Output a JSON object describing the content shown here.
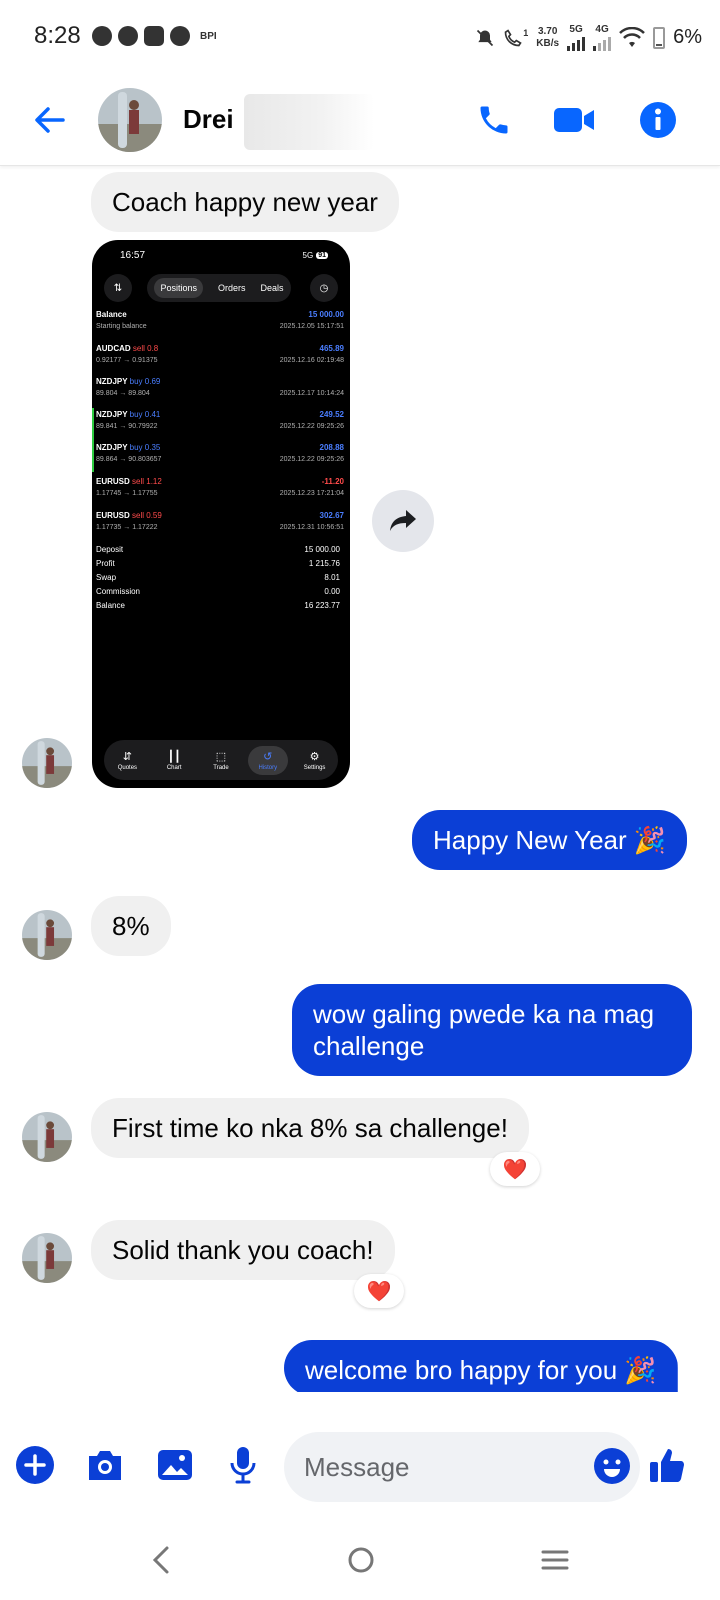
{
  "status_bar": {
    "time": "8:28",
    "carrier_tag": "BPI",
    "call_indicator": "1",
    "speed_value": "3.70",
    "speed_unit": "KB/s",
    "net1": "5G",
    "net2": "4G",
    "battery": "6%"
  },
  "header": {
    "contact_name": "Drei",
    "icons": [
      "back-arrow-icon",
      "phone-icon",
      "video-icon",
      "info-icon"
    ],
    "accent_color": "#0866ff"
  },
  "messages": [
    {
      "id": "m1",
      "direction": "in",
      "text": "Coach happy new year"
    },
    {
      "id": "m2",
      "direction": "in",
      "type": "image"
    },
    {
      "id": "m3",
      "direction": "out",
      "text": "Happy New Year 🎉"
    },
    {
      "id": "m4",
      "direction": "in",
      "text": "8%"
    },
    {
      "id": "m5",
      "direction": "out",
      "text": "wow galing pwede ka na mag challenge"
    },
    {
      "id": "m6",
      "direction": "in",
      "text": "First time ko nka 8% sa challenge!",
      "reaction": "❤️"
    },
    {
      "id": "m7",
      "direction": "in",
      "text": "Solid thank you coach!",
      "reaction": "❤️"
    },
    {
      "id": "m8",
      "direction": "out",
      "text": "welcome bro happy for you 🎉"
    }
  ],
  "shared_image": {
    "time": "16:57",
    "network": "5G",
    "battery": "91",
    "tabs": [
      "Positions",
      "Orders",
      "Deals"
    ],
    "active_tab": "Positions",
    "rows": [
      {
        "title": "Balance",
        "side": "",
        "sub": "Starting balance",
        "value": "15 000.00",
        "date": "2025.12.05 15:17:51"
      },
      {
        "title": "AUDCAD",
        "side": "sell 0.8",
        "sub": "0.92177 → 0.91375",
        "value": "465.89",
        "date": "2025.12.16 02:19:48"
      },
      {
        "title": "NZDJPY",
        "side": "buy 0.69",
        "sub": "89.804 → 89.804",
        "value": "",
        "date": "2025.12.17 10:14:24"
      },
      {
        "title": "NZDJPY",
        "side": "buy 0.41",
        "sub": "89.841 → 90.79922",
        "value": "249.52",
        "date": "2025.12.22 09:25:26"
      },
      {
        "title": "NZDJPY",
        "side": "buy 0.35",
        "sub": "89.864 → 90.803657",
        "value": "208.88",
        "date": "2025.12.22 09:25:26"
      },
      {
        "title": "EURUSD",
        "side": "sell 1.12",
        "sub": "1.17745 → 1.17755",
        "value": "-11.20",
        "date": "2025.12.23 17:21:04"
      },
      {
        "title": "EURUSD",
        "side": "sell 0.59",
        "sub": "1.17735 → 1.17222",
        "value": "302.67",
        "date": "2025.12.31 10:56:51"
      }
    ],
    "summary": [
      {
        "label": "Deposit",
        "value": "15 000.00"
      },
      {
        "label": "Profit",
        "value": "1 215.76"
      },
      {
        "label": "Swap",
        "value": "8.01"
      },
      {
        "label": "Commission",
        "value": "0.00"
      },
      {
        "label": "Balance",
        "value": "16 223.77"
      }
    ],
    "nav": [
      "Quotes",
      "Chart",
      "Trade",
      "History",
      "Settings"
    ],
    "active_nav": "History"
  },
  "composer": {
    "placeholder": "Message",
    "icons": [
      "plus-icon",
      "camera-icon",
      "gallery-icon",
      "microphone-icon",
      "emoji-icon",
      "thumbs-up-icon"
    ]
  },
  "system_nav": [
    "back-icon",
    "home-icon",
    "recents-icon"
  ]
}
